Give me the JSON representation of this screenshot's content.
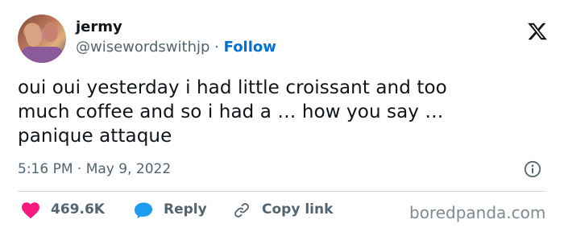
{
  "author": {
    "display_name": "jermy",
    "handle": "@wisewordswithjp",
    "separator": "·",
    "follow_label": "Follow"
  },
  "tweet": {
    "line1": "oui oui yesterday i had little croissant and too",
    "line2": "much coffee and so i had a … how you say …",
    "line3": "panique attaque",
    "time": "5:16 PM",
    "separator": "·",
    "date": "May 9, 2022"
  },
  "actions": {
    "likes": "469.6K",
    "reply_label": "Reply",
    "copy_link_label": "Copy link"
  },
  "watermark": "boredpanda.com",
  "colors": {
    "follow": "#006fd6",
    "like": "#f91880",
    "reply": "#1d9bf0",
    "muted": "#536471"
  },
  "icons": {
    "brand": "x-logo-icon",
    "info": "info-icon",
    "like": "heart-icon",
    "reply": "speech-bubble-icon",
    "copy": "link-icon"
  }
}
